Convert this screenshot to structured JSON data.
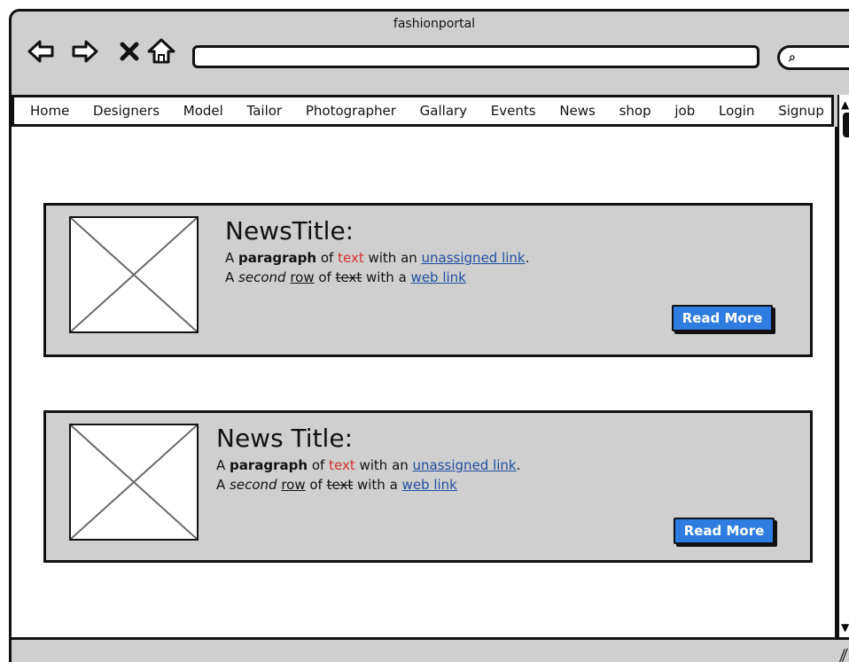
{
  "window": {
    "title": "fashionportal"
  },
  "menu": [
    "Home",
    "Designers",
    "Model",
    "Tailor",
    "Photographer",
    "Gallary",
    "Events",
    "News",
    "shop",
    "job",
    "Login",
    "Signup"
  ],
  "cards": [
    {
      "title": "NewsTitle:",
      "p1": {
        "a": "A ",
        "bold": "paragraph",
        "b": " of ",
        "red": "text",
        "c": " with an ",
        "link": "unassigned link",
        "d": "."
      },
      "p2": {
        "a": "A ",
        "italic": "second",
        "b": " ",
        "u": "row",
        "c": " of ",
        "s": "text",
        "d": " with a ",
        "link": "web link"
      },
      "button": "Read More"
    },
    {
      "title": "News Title:",
      "p1": {
        "a": "A ",
        "bold": "paragraph",
        "b": " of ",
        "red": "text",
        "c": " with an ",
        "link": "unassigned link",
        "d": "."
      },
      "p2": {
        "a": "A ",
        "italic": "second",
        "b": " ",
        "u": "row",
        "c": " of ",
        "s": "text",
        "d": " with a ",
        "link": "web link"
      },
      "button": "Read More"
    }
  ],
  "icons": {
    "back": "back-arrow-icon",
    "forward": "forward-arrow-icon",
    "stop": "close-icon",
    "home": "home-icon",
    "search": "search-icon",
    "resize": "resize-grip-icon"
  },
  "colors": {
    "button": "#2f7de1",
    "link": "#1f4fa0",
    "red": "#d32f2f",
    "chrome": "#cfcfcf"
  }
}
